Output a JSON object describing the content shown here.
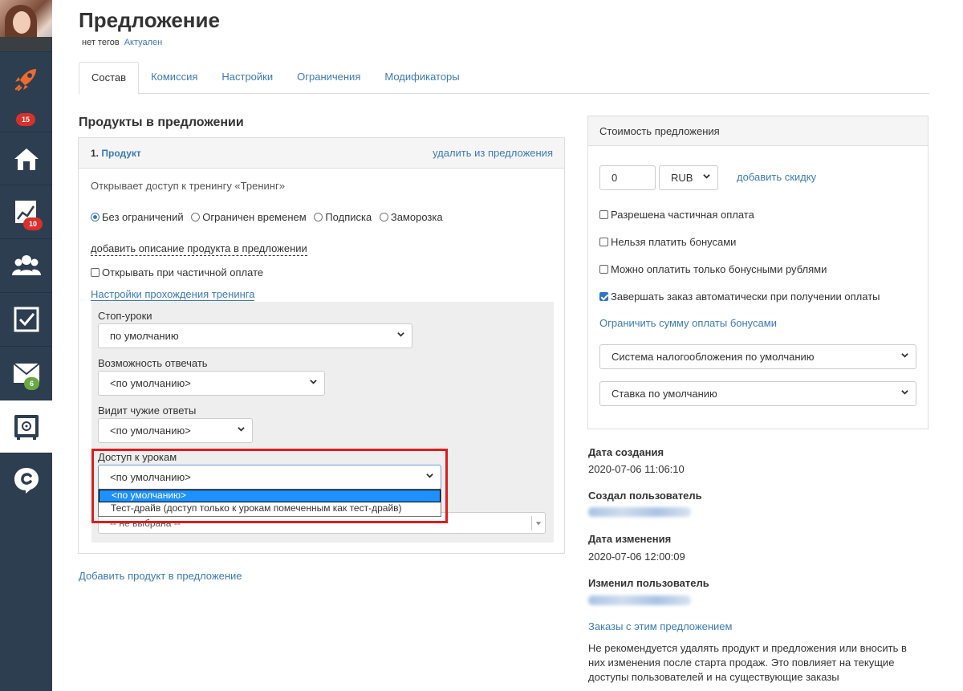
{
  "header": {
    "title": "Предложение",
    "tags": "нет тегов",
    "status": "Актуален"
  },
  "sidebar": {
    "items": [
      {
        "icon": "rocket-icon",
        "badge": "15"
      },
      {
        "icon": "home-icon"
      },
      {
        "icon": "chart-icon",
        "badge": "10"
      },
      {
        "icon": "users-icon"
      },
      {
        "icon": "checkbox-icon"
      },
      {
        "icon": "mail-icon",
        "badge": "6"
      },
      {
        "icon": "safe-icon",
        "active": true
      },
      {
        "icon": "brand-icon"
      }
    ]
  },
  "tabs": [
    "Состав",
    "Комиссия",
    "Настройки",
    "Ограничения",
    "Модификаторы"
  ],
  "products": {
    "section_title": "Продукты в предложении",
    "item": {
      "number": "1.",
      "name": "Продукт",
      "remove_label": "удалить из предложения",
      "description": "Открывает доступ к тренингу «Тренинг»",
      "access_options": [
        "Без ограничений",
        "Ограничен временем",
        "Подписка",
        "Заморозка"
      ],
      "add_description": "добавить описание продукта в предложении",
      "open_partial": "Открывать при частичной оплате",
      "training_settings": "Настройки прохождения тренинга",
      "stop_lessons_label": "Стоп-уроки",
      "stop_lessons_value": "по умолчанию",
      "can_answer_label": "Возможность отвечать",
      "can_answer_value": "<по умолчанию>",
      "sees_answers_label": "Видит чужие ответы",
      "sees_answers_value": "<по умолчанию>",
      "lesson_access_label": "Доступ к урокам",
      "lesson_access_value": "<по умолчанию>",
      "lesson_access_options": [
        "<по умолчанию>",
        "Тест-драйв (доступ только к урокам помеченным как тест-драйв)"
      ],
      "hidden_select_value": "-- не выбрана --"
    },
    "add_product": "Добавить продукт в предложение"
  },
  "cost": {
    "title": "Стоимость предложения",
    "price": "0",
    "currency": "RUB",
    "add_discount": "добавить скидку",
    "checkboxes": [
      {
        "label": "Разрешена частичная оплата",
        "checked": false
      },
      {
        "label": "Нельзя платить бонусами",
        "checked": false
      },
      {
        "label": "Можно оплатить только бонусными рублями",
        "checked": false
      },
      {
        "label": "Завершать заказ автоматически при получении оплаты",
        "checked": true
      }
    ],
    "limit_bonus": "Ограничить сумму оплаты бонусами",
    "tax_system": "Система налогообложения по умолчанию",
    "tax_rate": "Ставка по умолчанию"
  },
  "meta": {
    "created_label": "Дата создания",
    "created_value": "2020-07-06 11:06:10",
    "creator_label": "Создал пользователь",
    "modified_label": "Дата изменения",
    "modified_value": "2020-07-06 12:00:09",
    "modifier_label": "Изменил пользователь",
    "orders_link": "Заказы с этим предложением",
    "warning": "Не рекомендуется удалять продукт и предложения или вносить в них изменения после старта продаж. Это повлияет на текущие доступы пользователей и на существующие заказы"
  },
  "colors": {
    "sidebar": "#2d3e50",
    "link": "#3c7ab5",
    "accent_orange": "#f26a2b",
    "highlight_red": "#e01b1b",
    "option_selected": "#1e90ff"
  }
}
